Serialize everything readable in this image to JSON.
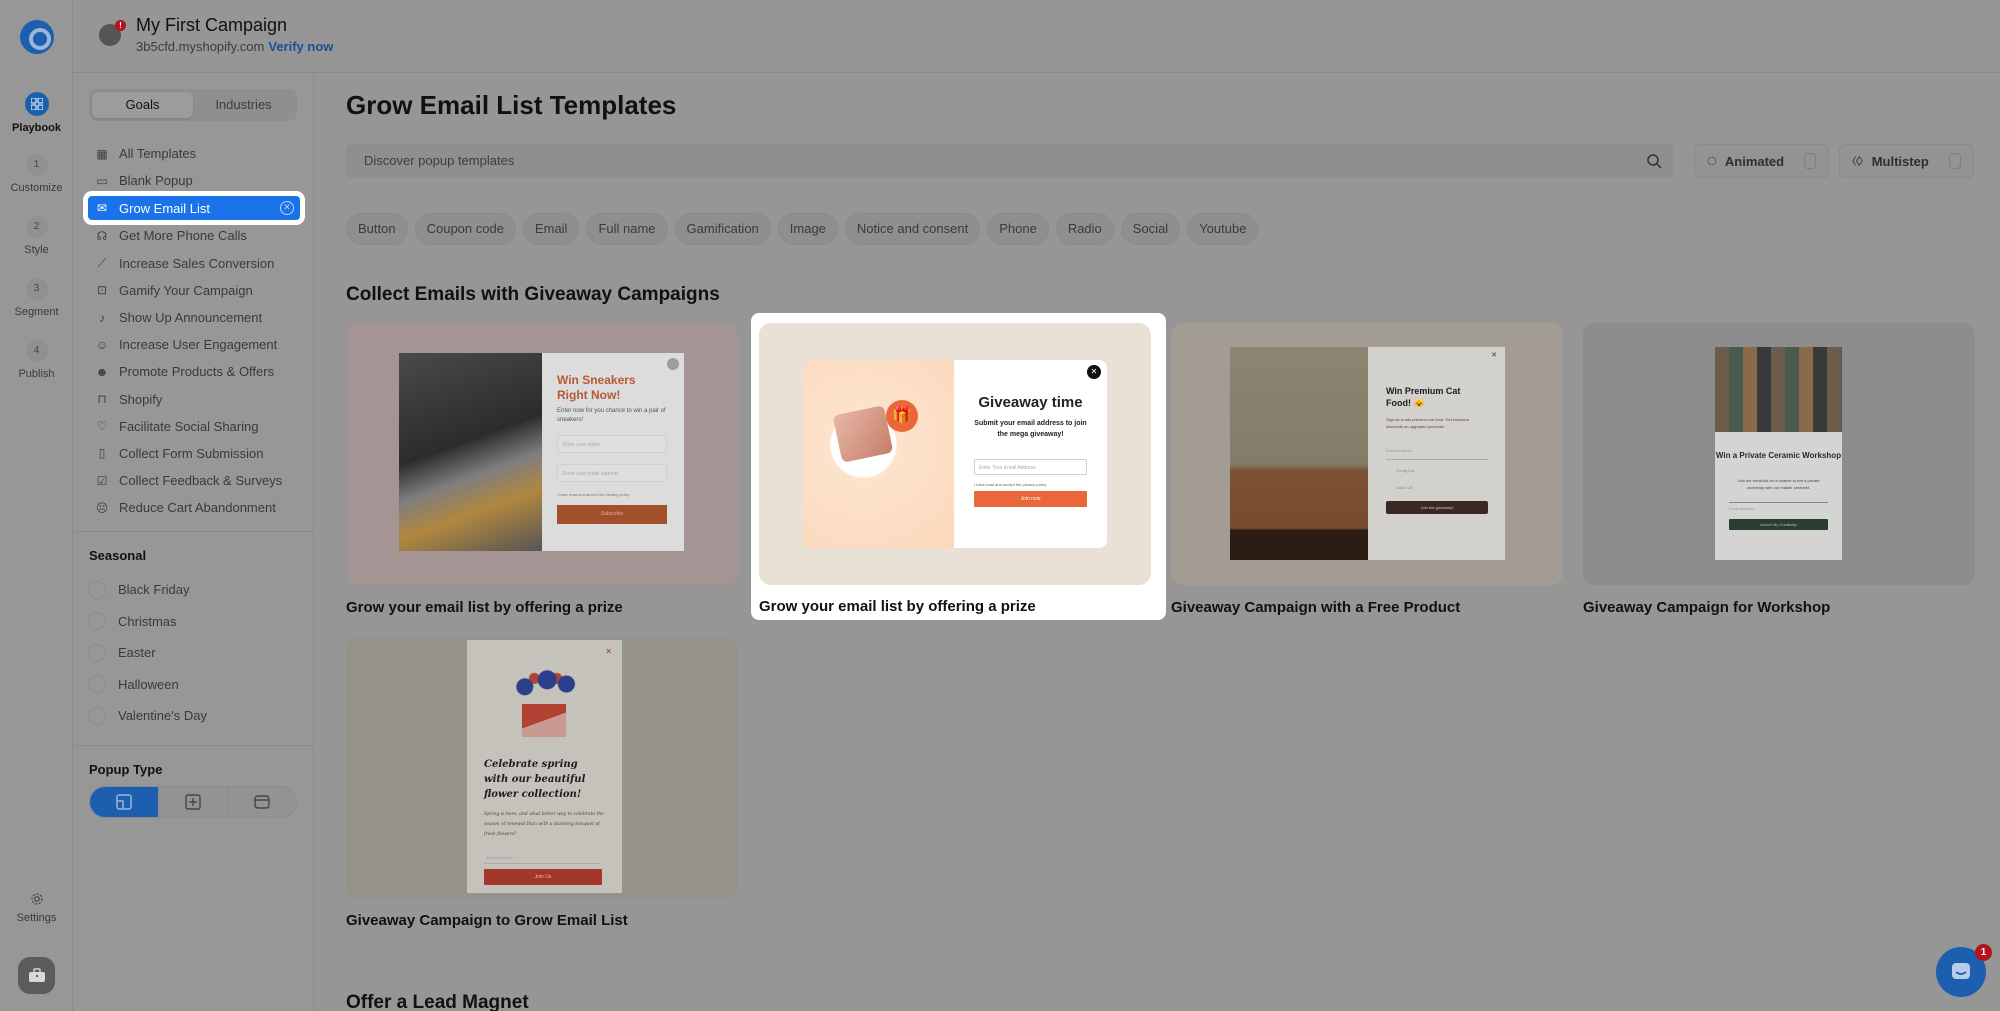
{
  "app": {
    "campaign_title": "My First Campaign",
    "store_domain": "3b5cfd.myshopify.com",
    "verify_link": "Verify now",
    "notification_mark": "!"
  },
  "rail": {
    "items": [
      {
        "step": "",
        "label": "Playbook",
        "icon": "grid-icon",
        "active": true
      },
      {
        "step": "1",
        "label": "Customize"
      },
      {
        "step": "2",
        "label": "Style"
      },
      {
        "step": "3",
        "label": "Segment"
      },
      {
        "step": "4",
        "label": "Publish"
      }
    ],
    "settings_label": "Settings"
  },
  "sidebar": {
    "tabs": [
      {
        "label": "Goals",
        "active": true
      },
      {
        "label": "Industries"
      }
    ],
    "goals": [
      {
        "label": "All Templates",
        "icon": "grid-icon"
      },
      {
        "label": "Blank Popup",
        "icon": "popup-icon"
      },
      {
        "label": "Grow Email List",
        "icon": "envelope-open-icon",
        "active": true
      },
      {
        "label": "Get More Phone Calls",
        "icon": "headphones-icon"
      },
      {
        "label": "Increase Sales Conversion",
        "icon": "chart-line-icon"
      },
      {
        "label": "Gamify Your Campaign",
        "icon": "gamepad-icon"
      },
      {
        "label": "Show Up Announcement",
        "icon": "bell-icon"
      },
      {
        "label": "Increase User Engagement",
        "icon": "users-icon"
      },
      {
        "label": "Promote Products & Offers",
        "icon": "megaphone-user-icon"
      },
      {
        "label": "Shopify",
        "icon": "shopify-bag-icon"
      },
      {
        "label": "Facilitate Social Sharing",
        "icon": "heart-icon"
      },
      {
        "label": "Collect Form Submission",
        "icon": "form-icon"
      },
      {
        "label": "Collect Feedback & Surveys",
        "icon": "feedback-icon"
      },
      {
        "label": "Reduce Cart Abandonment",
        "icon": "sad-face-icon"
      }
    ],
    "seasonal_title": "Seasonal",
    "seasonal": [
      "Black Friday",
      "Christmas",
      "Easter",
      "Halloween",
      "Valentine's Day"
    ],
    "popup_type_title": "Popup Type",
    "popup_types": [
      {
        "name": "modal",
        "active": true
      },
      {
        "name": "fullscreen"
      },
      {
        "name": "bar"
      }
    ]
  },
  "main": {
    "title": "Grow Email List Templates",
    "search_placeholder": "Discover popup templates",
    "animated_label": "Animated",
    "multistep_label": "Multistep",
    "filters": [
      "Button",
      "Coupon code",
      "Email",
      "Full name",
      "Gamification",
      "Image",
      "Notice and consent",
      "Phone",
      "Radio",
      "Social",
      "Youtube"
    ],
    "section1_title": "Collect Emails with Giveaway Campaigns",
    "section2_title": "Offer a Lead Magnet",
    "cards": [
      {
        "caption": "Grow your email list by offering a prize",
        "popup_title": "Win Sneakers Right Now!",
        "popup_text": "Enter now for you chance to win a pair of sneakers!",
        "name_placeholder": "Enter your name",
        "email_placeholder": "Enter your email address",
        "consent": "I have read and accept the privacy policy",
        "button": "Subscribe"
      },
      {
        "caption": "Grow your email list by offering a prize",
        "popup_title": "Giveaway time",
        "popup_text": "Submit your email address to join the mega giveaway!",
        "email_placeholder": "Enter Your Email Address",
        "consent": "I have read and accept the privacy policy",
        "button": "Join now",
        "highlighted": true
      },
      {
        "caption": "Giveaway Campaign with a Free Product",
        "popup_title": "Win Premium Cat Food! 😺",
        "popup_text": "Sign up to win premium cat food. Get exclusive discounts on upgraded products!",
        "email_placeholder": "Email Address",
        "options": [
          "Young Cat",
          "Adult Cat"
        ],
        "button": "Join the giveaway!"
      },
      {
        "caption": "Giveaway Campaign for Workshop",
        "popup_title": "Win a Private Ceramic Workshop",
        "popup_text": "Join our email list for a chance to win a private workshop with our master ceramist.",
        "email_placeholder": "Email Address",
        "button": "Unlock My Creativity!"
      },
      {
        "caption": "Giveaway Campaign to Grow Email List",
        "popup_title": "Celebrate spring with our beautiful flower collection!",
        "popup_text": "Spring is here, and what better way to celebrate the season of renewal than with a stunning bouquet of fresh flowers?",
        "email_placeholder": "Email Address",
        "button": "Join Us"
      }
    ]
  },
  "chat": {
    "badge": "1"
  },
  "colors": {
    "accent": "#1a73e8",
    "brand": "#1b5fae",
    "cta_orange": "#e8683a",
    "badge_red": "#b3141b"
  }
}
